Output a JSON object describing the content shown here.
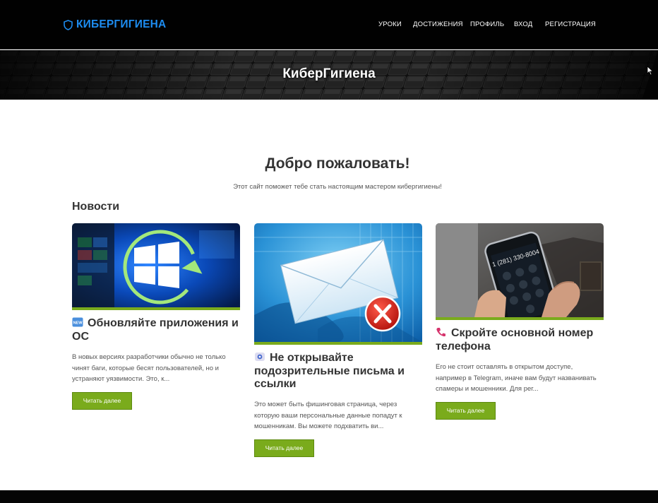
{
  "nav": {
    "brand": "КИБЕРГИГИЕНА",
    "items": [
      "УРОКИ",
      "ДОСТИЖЕНИЯ",
      "ПРОФИЛЬ",
      "ВХОД",
      "РЕГИСТРАЦИЯ"
    ]
  },
  "hero": {
    "title": "КиберГигиена"
  },
  "main": {
    "welcome_title": "Добро пожаловать!",
    "welcome_subtitle": "Этот сайт поможет тебе стать настоящим мастером кибергигиены!",
    "news_heading": "Новости"
  },
  "cards": [
    {
      "icon": "new-badge-icon",
      "title": "Обновляйте приложения и ОС",
      "text": "В новых версиях разработчики обычно не только чинят баги, которые бесят пользователей, но и устраняют уязвимости. Это, к...",
      "button": "Читать далее",
      "image": "windows-update-image"
    },
    {
      "icon": "shield-badge-icon",
      "title": "Не открывайте подозрительные письма и ссылки",
      "text": "Это может быть фишинговая страница, через которую ваши персональные данные попадут к мошенникам. Вы можете подхватить ви...",
      "button": "Читать далее",
      "image": "phishing-email-image"
    },
    {
      "icon": "phone-icon",
      "title": "Скройте основной номер телефона",
      "text": "Его не стоит оставлять в открытом доступе, например в Telegram, иначе вам будут названивать спамеры и мошенники. Для рег...",
      "button": "Читать далее",
      "image": "phone-in-hand-image"
    }
  ],
  "colors": {
    "brand": "#1d8cf0",
    "accent_green": "#7aab1c",
    "nav_bg": "#010101",
    "text_dark": "#333333"
  }
}
